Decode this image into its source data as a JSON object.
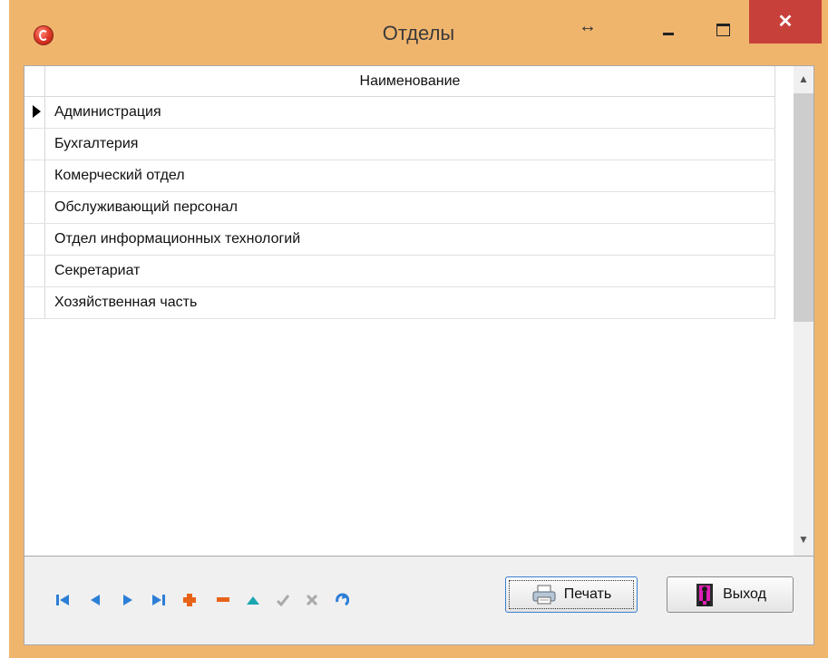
{
  "window": {
    "title": "Отделы"
  },
  "grid": {
    "column_header": "Наименование",
    "rows": [
      "Администрация",
      "Бухгалтерия",
      "Комерческий отдел",
      "Обслуживающий персонал",
      "Отдел информационных технологий",
      "Секретариат",
      "Хозяйственная часть"
    ],
    "selected_index": 0
  },
  "scrollbar": {
    "up_icon": "▲",
    "down_icon": "▼"
  },
  "navigator": {
    "icons": [
      "first-icon",
      "prior-icon",
      "next-icon",
      "last-icon",
      "insert-icon",
      "delete-icon",
      "edit-icon",
      "post-icon",
      "cancel-icon",
      "refresh-icon"
    ]
  },
  "buttons": {
    "print_label": "Печать",
    "exit_label": "Выход"
  },
  "titlebar": {
    "close_symbol": "✕",
    "resize_symbol": "↔"
  },
  "colors": {
    "frame": "#f0b56d",
    "close": "#c8403a",
    "nav_blue": "#2c7fd6",
    "nav_orange": "#e8631a",
    "nav_teal": "#1ba6b0",
    "nav_gray": "#a9a9a9"
  }
}
